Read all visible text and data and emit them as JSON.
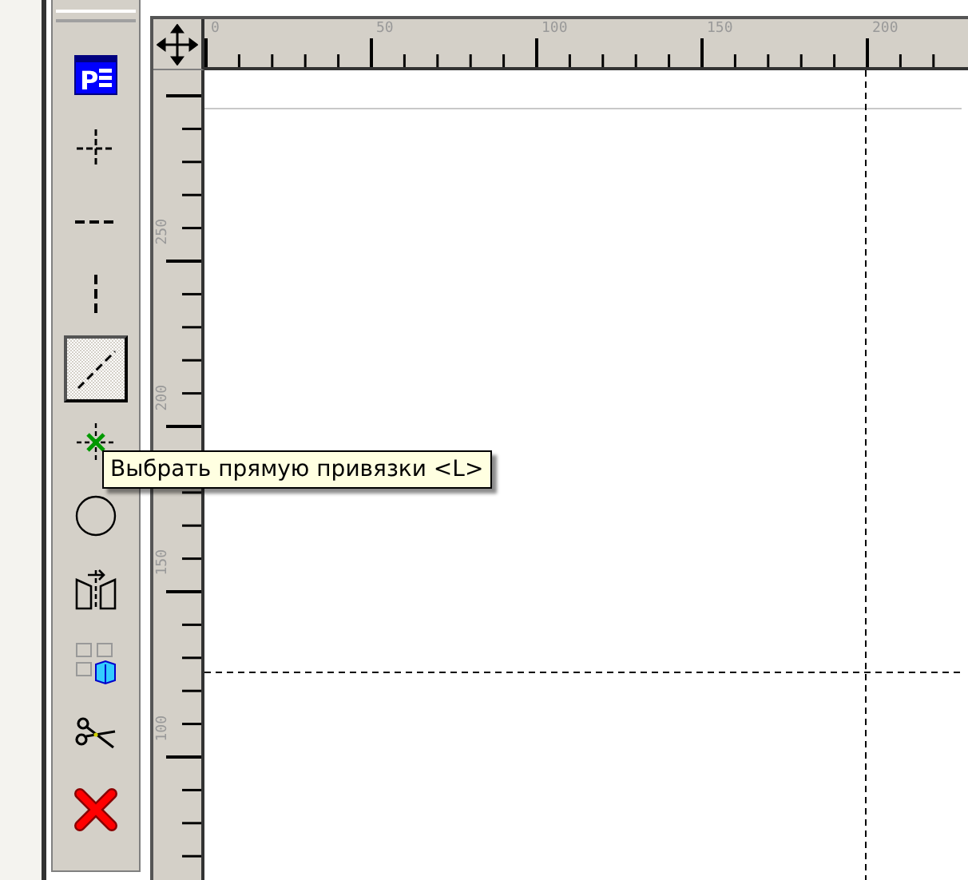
{
  "toolbar": {
    "tools": [
      {
        "kind": "page",
        "label": "P",
        "selected": false
      },
      {
        "kind": "cross",
        "selected": false
      },
      {
        "kind": "horizontal",
        "selected": false
      },
      {
        "kind": "vertical",
        "selected": false
      },
      {
        "kind": "diagonal",
        "selected": true
      },
      {
        "kind": "snap",
        "selected": false
      },
      {
        "kind": "circle",
        "selected": false
      },
      {
        "kind": "mirror",
        "selected": false
      },
      {
        "kind": "grid",
        "selected": false
      },
      {
        "kind": "scissors",
        "selected": false
      },
      {
        "kind": "delete",
        "selected": false
      }
    ]
  },
  "top_ruler": {
    "labels": [
      "0",
      "50",
      "100",
      "150",
      "200"
    ]
  },
  "left_ruler": {
    "labels": [
      "250",
      "200",
      "150",
      "100"
    ]
  },
  "tooltip": {
    "text": "Выбрать прямую привязки <L>"
  }
}
